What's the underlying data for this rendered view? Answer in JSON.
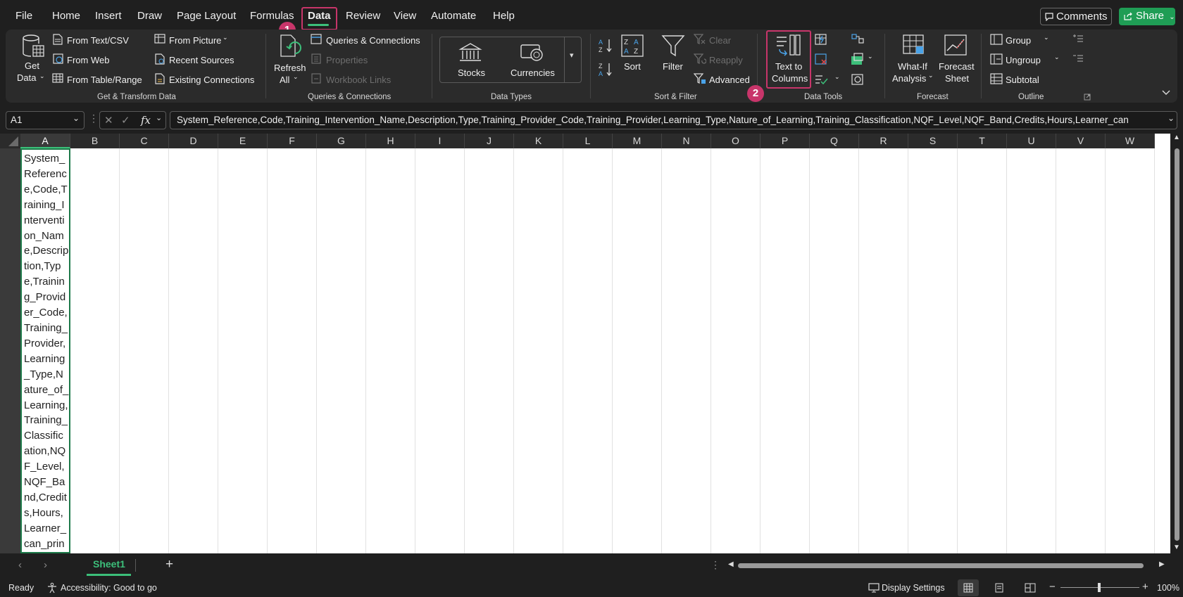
{
  "menu": {
    "file": "File",
    "home": "Home",
    "insert": "Insert",
    "draw": "Draw",
    "page_layout": "Page Layout",
    "formulas": "Formulas",
    "data": "Data",
    "review": "Review",
    "view": "View",
    "automate": "Automate",
    "help": "Help"
  },
  "top_buttons": {
    "comments": "Comments",
    "share": "Share"
  },
  "annotations": {
    "step1": "1",
    "step2": "2"
  },
  "ribbon": {
    "get_transform": {
      "get_data": "Get",
      "get_data_2": "Data",
      "from_text_csv": "From Text/CSV",
      "from_web": "From Web",
      "from_table_range": "From Table/Range",
      "from_picture": "From Picture",
      "recent_sources": "Recent Sources",
      "existing_connections": "Existing Connections",
      "group_label": "Get & Transform Data"
    },
    "queries": {
      "refresh": "Refresh",
      "refresh_2": "All",
      "queries_connections": "Queries & Connections",
      "properties": "Properties",
      "workbook_links": "Workbook Links",
      "group_label": "Queries & Connections"
    },
    "data_types": {
      "stocks": "Stocks",
      "currencies": "Currencies",
      "group_label": "Data Types"
    },
    "sort_filter": {
      "sort": "Sort",
      "filter": "Filter",
      "clear": "Clear",
      "reapply": "Reapply",
      "advanced": "Advanced",
      "group_label": "Sort & Filter"
    },
    "data_tools": {
      "text_to": "Text to",
      "columns": "Columns",
      "group_label": "Data Tools"
    },
    "forecast": {
      "what_if": "What-If",
      "analysis": "Analysis",
      "forecast": "Forecast",
      "sheet": "Sheet",
      "group_label": "Forecast"
    },
    "outline": {
      "group": "Group",
      "ungroup": "Ungroup",
      "subtotal": "Subtotal",
      "group_label": "Outline"
    }
  },
  "formula_bar": {
    "name_box": "A1",
    "fx": "fx",
    "formula": "System_Reference,Code,Training_Intervention_Name,Description,Type,Training_Provider_Code,Training_Provider,Learning_Type,Nature_of_Learning,Training_Classification,NQF_Level,NQF_Band,Credits,Hours,Learner_can"
  },
  "columns": [
    "A",
    "B",
    "C",
    "D",
    "E",
    "F",
    "G",
    "H",
    "I",
    "J",
    "K",
    "L",
    "M",
    "N",
    "O",
    "P",
    "Q",
    "R",
    "S",
    "T",
    "U",
    "V",
    "W"
  ],
  "cell_a1": "System_Reference,Code,Training_Intervention_Name,Description,Type,Training_Provider_Code,Training_Provider,Learning_Type,Nature_of_Learning,Training_Classification,NQF_Level,NQF_Band,Credits,Hours,Learner_can_prin",
  "sheet_tab": "Sheet1",
  "status": {
    "ready": "Ready",
    "accessibility": "Accessibility: Good to go",
    "display_settings": "Display Settings",
    "zoom": "100%"
  },
  "colors": {
    "accent_green": "#3cbf7a",
    "highlight": "#c8356a",
    "share_bg": "#1f9d55"
  }
}
